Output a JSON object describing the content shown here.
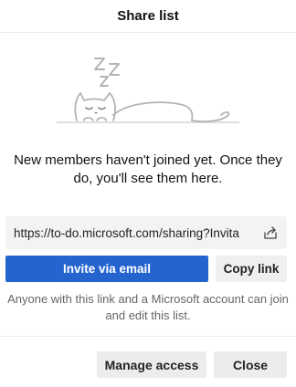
{
  "header": {
    "title": "Share list"
  },
  "illustration": {
    "name": "sleeping-cat-illustration",
    "sleep_letters": [
      "Z",
      "Z",
      "Z"
    ]
  },
  "empty_state": {
    "message": "New members haven't joined yet. Once they do, you'll see them here."
  },
  "share_link": {
    "url": "https://to-do.microsoft.com/sharing?Invita",
    "share_icon": "share-icon"
  },
  "actions": {
    "invite_label": "Invite via email",
    "copy_label": "Copy link"
  },
  "link_note": "Anyone with this link and a Microsoft account can join and edit this list.",
  "footer": {
    "manage_label": "Manage access",
    "close_label": "Close"
  },
  "colors": {
    "primary": "#2564cf",
    "secondary_button": "#efefef",
    "link_box": "#f3f3f3",
    "illustration_stroke": "#b3b3b3"
  }
}
